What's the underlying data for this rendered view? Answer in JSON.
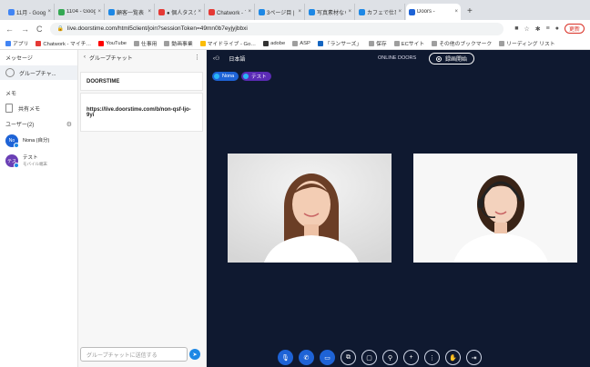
{
  "browser": {
    "tabs": [
      {
        "label": "11月 - Google",
        "color": "#4285f4"
      },
      {
        "label": "1104 - Google",
        "color": "#34a853"
      },
      {
        "label": "顧客一覧表 - ",
        "color": "#1e88e5"
      },
      {
        "label": "● 個人タスク",
        "color": "#e53935"
      },
      {
        "label": "Chatwork - マ",
        "color": "#e53935"
      },
      {
        "label": "3ページ目 | A",
        "color": "#1e88e5"
      },
      {
        "label": "写真素材なら",
        "color": "#1e88e5"
      },
      {
        "label": "カフェで仕事",
        "color": "#1e88e5"
      },
      {
        "label": "Doors - ",
        "color": "#1e63d6"
      }
    ],
    "new_tab": "+",
    "url": "live.doorstime.com/html5client/join?sessionToken=49mn0b7eyjyjbbxi",
    "update_label": "更新",
    "bookmarks": [
      {
        "label": "アプリ",
        "color": "#4285f4"
      },
      {
        "label": "Chatwork - マイチ…",
        "color": "#e53935"
      },
      {
        "label": "YouTube",
        "color": "#ff0000"
      },
      {
        "label": "仕事用",
        "color": "#9e9e9e"
      },
      {
        "label": "動画事業",
        "color": "#9e9e9e"
      },
      {
        "label": "マイドライブ - Go…",
        "color": "#fbbc05"
      },
      {
        "label": "adobe",
        "color": "#333333"
      },
      {
        "label": "ASP",
        "color": "#9e9e9e"
      },
      {
        "label": "「ランサーズ」",
        "color": "#1565c0"
      },
      {
        "label": "保存",
        "color": "#9e9e9e"
      },
      {
        "label": "ECサイト",
        "color": "#9e9e9e"
      },
      {
        "label": "その他のブックマーク",
        "color": "#9e9e9e"
      },
      {
        "label": "リーディング リスト",
        "color": "#9e9e9e"
      }
    ]
  },
  "left": {
    "messages_heading": "メッセージ",
    "group_chat": "グループチャ...",
    "memo_heading": "メモ",
    "shared_memo": "共有メモ",
    "users_heading": "ユーザー(2)",
    "users": [
      {
        "initials": "No",
        "name": "Nona (自分)",
        "sub": "",
        "color": "#1e63d6"
      },
      {
        "initials": "テス",
        "name": "テスト",
        "sub": "モバイル端末",
        "color": "#6a3fb5"
      }
    ]
  },
  "chat": {
    "header": "グループチャット",
    "messages": [
      "DOORSTIME",
      "https://live.doorstime.com/b/non-qsf-ljo-9yi"
    ],
    "input_placeholder": "グループチャットに送信する"
  },
  "video": {
    "room_name": "日本語",
    "status": "ONLINE DOORS",
    "record_label": "録画開始",
    "participants": [
      {
        "name": "Nona",
        "color": "#1e63d6"
      },
      {
        "name": "テスト",
        "color": "#5b2bb5"
      }
    ],
    "controls": [
      {
        "icon": "microphone-icon",
        "glyph": "🎙",
        "active": true
      },
      {
        "icon": "phone-icon",
        "glyph": "✆",
        "active": true
      },
      {
        "icon": "camera-icon",
        "glyph": "▭",
        "active": true
      },
      {
        "icon": "screen-share-icon",
        "glyph": "⧉",
        "active": false
      },
      {
        "icon": "whiteboard-icon",
        "glyph": "▢",
        "active": false
      },
      {
        "icon": "search-user-icon",
        "glyph": "⚲",
        "active": false
      },
      {
        "icon": "plus-icon",
        "glyph": "+",
        "active": false
      },
      {
        "icon": "more-icon",
        "glyph": "⋮",
        "active": false
      },
      {
        "icon": "hand-icon",
        "glyph": "✋",
        "active": false
      },
      {
        "icon": "exit-icon",
        "glyph": "⇥",
        "active": false
      }
    ]
  }
}
